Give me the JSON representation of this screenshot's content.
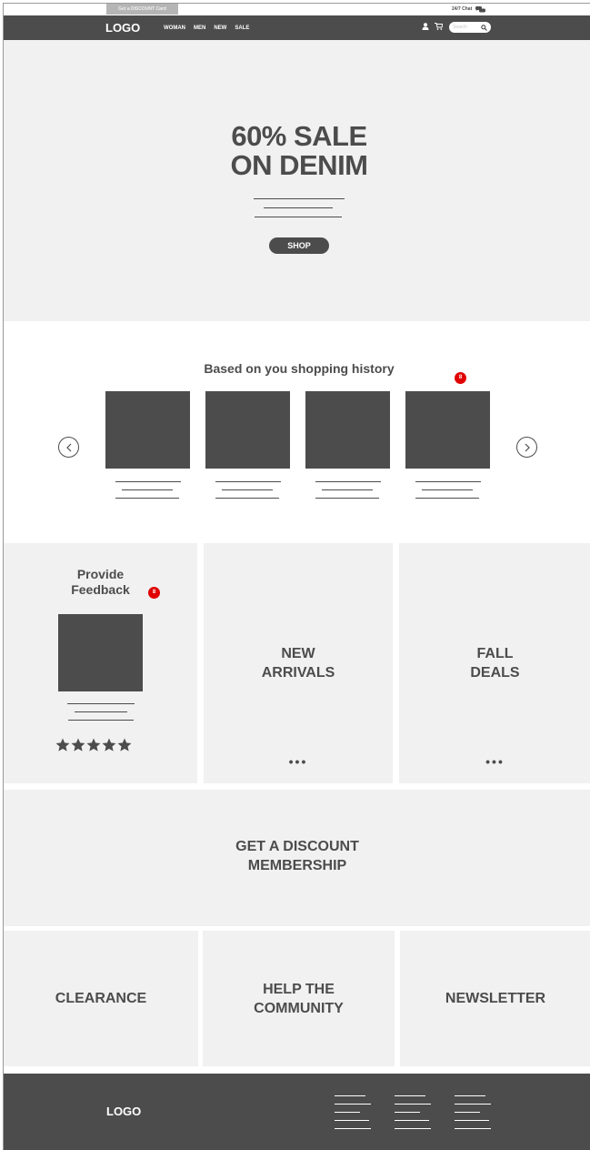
{
  "topbar": {
    "discount_tab": "Get a DISCOUNT Card",
    "chat_label": "24/7 Chat",
    "chat_icon": "chat-bubbles-icon"
  },
  "nav": {
    "logo": "LOGO",
    "links": [
      "WOMAN",
      "MEN",
      "NEW",
      "SALE"
    ],
    "user_icon": "user-icon",
    "cart_icon": "cart-icon",
    "search_placeholder": "Search",
    "search_icon": "search-icon"
  },
  "hero": {
    "title_line1": "60% SALE",
    "title_line2": "ON DENIM",
    "shop_label": "SHOP"
  },
  "history": {
    "title": "Based on you shopping history",
    "badge": "8",
    "prev_icon": "chevron-left-icon",
    "next_icon": "chevron-right-icon",
    "product_count": 4
  },
  "tiles": {
    "feedback_line1": "Provide",
    "feedback_line2": "Feedback",
    "feedback_badge": "8",
    "rating": 5,
    "rating_max": 5,
    "new_arrivals_line1": "NEW",
    "new_arrivals_line2": "ARRIVALS",
    "fall_line1": "FALL",
    "fall_line2": "DEALS",
    "more_dots": "•••",
    "membership_line1": "GET A DISCOUNT",
    "membership_line2": "MEMBERSHIP",
    "clearance": "CLEARANCE",
    "help_line1": "HELP THE",
    "help_line2": "COMMUNITY",
    "newsletter": "NEWSLETTER"
  },
  "footer": {
    "logo": "LOGO"
  },
  "colors": {
    "dark": "#4c4c4c",
    "panel": "#f1f1f1",
    "badge": "#e00000"
  }
}
